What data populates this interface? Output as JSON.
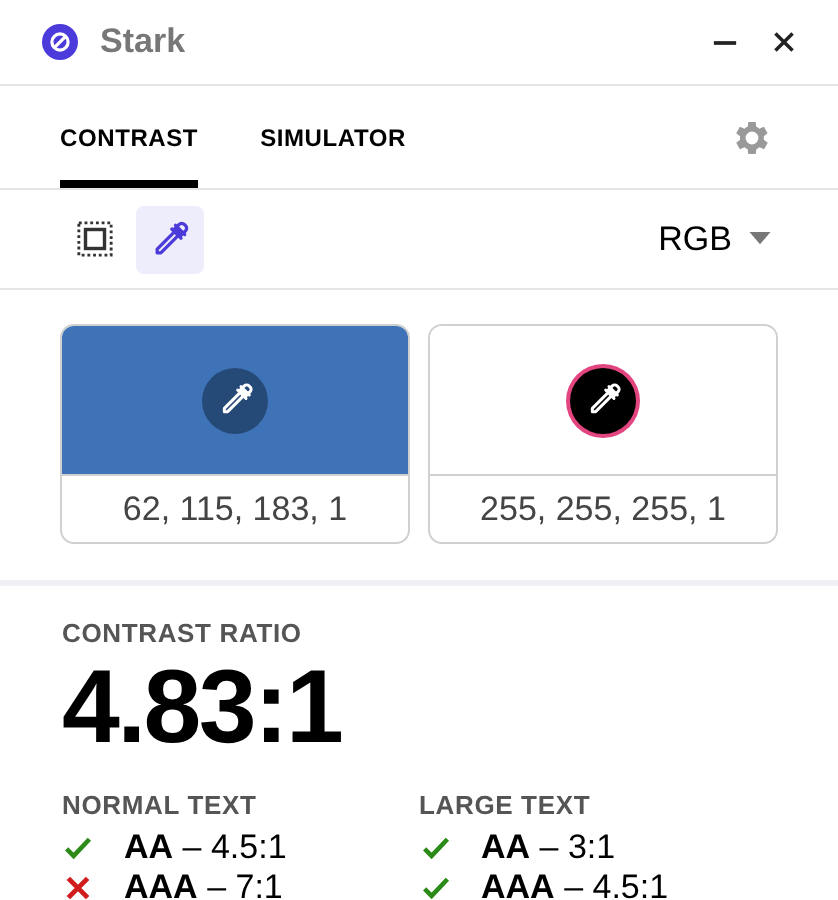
{
  "window": {
    "title": "Stark"
  },
  "tabs": [
    {
      "label": "CONTRAST",
      "selected": true
    },
    {
      "label": "SIMULATOR",
      "selected": false
    }
  ],
  "tools": [
    {
      "kind": "selection",
      "selected": false
    },
    {
      "kind": "eyedropper",
      "selected": true
    }
  ],
  "color_mode": "RGB",
  "swatches": [
    {
      "color": "#3e73b7",
      "value": "62, 115, 183, 1",
      "selected": false
    },
    {
      "color": "#ffffff",
      "value": "255, 255, 255, 1",
      "selected": true
    }
  ],
  "contrast": {
    "label": "CONTRAST RATIO",
    "ratio": "4.83:1"
  },
  "groups": [
    {
      "title": "NORMAL TEXT",
      "results": [
        {
          "text": "**AA** – 4.5:1",
          "passed": true
        },
        {
          "text": "**AAA** – 7:1",
          "passed": false
        }
      ]
    },
    {
      "title": "LARGE TEXT",
      "results": [
        {
          "text": "**AA** – 3:1",
          "passed": true
        },
        {
          "text": "**AAA** – 4.5:1",
          "passed": true
        }
      ]
    }
  ]
}
